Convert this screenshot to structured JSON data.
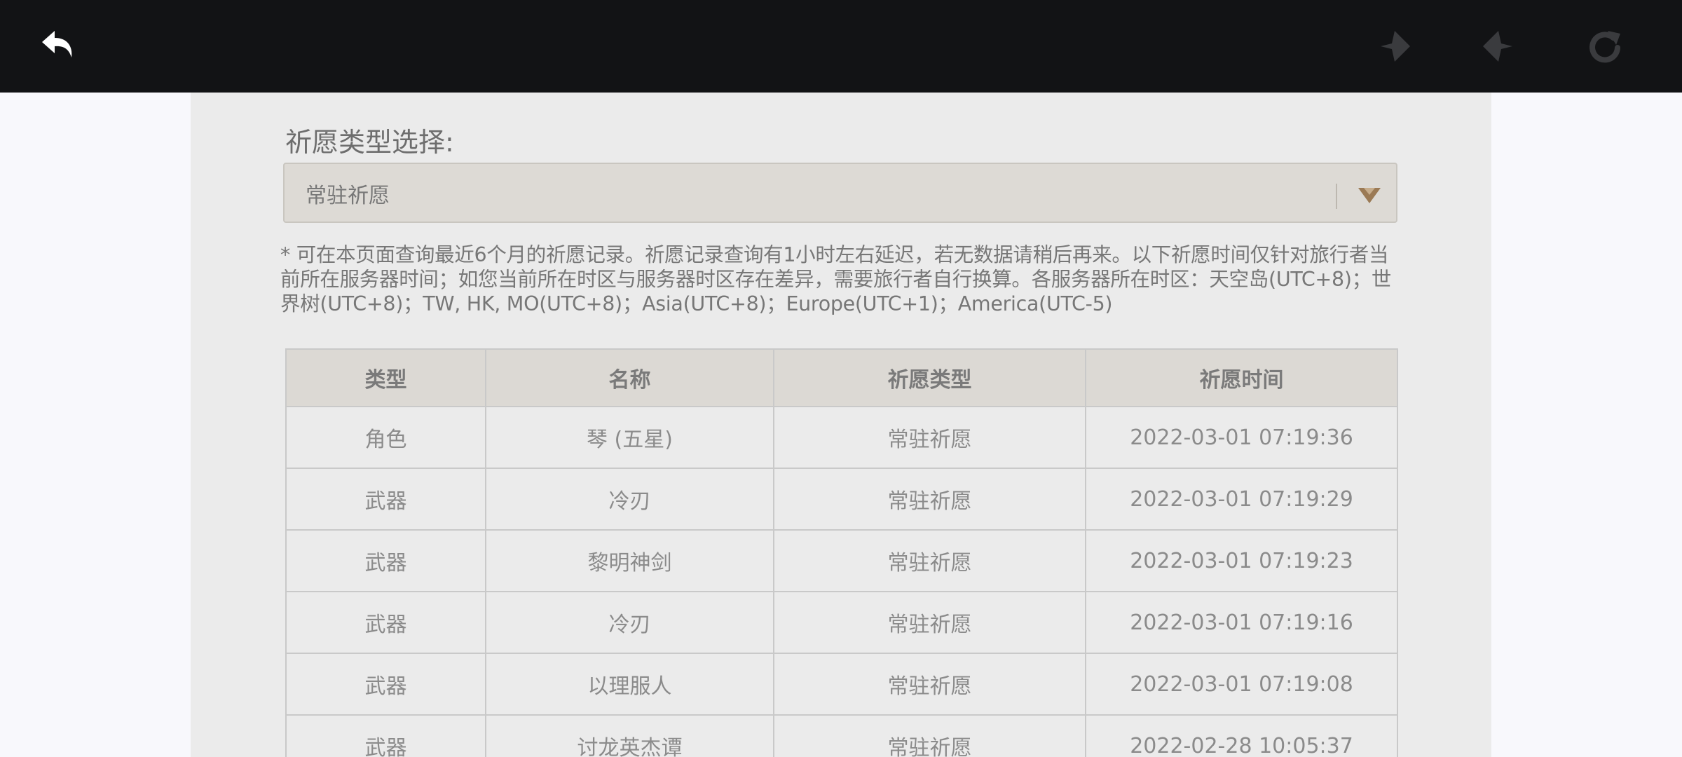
{
  "toolbar": {
    "back_icon": "undo-arrow-icon",
    "prev_icon": "diamond-left-icon",
    "next_icon": "diamond-right-icon",
    "refresh_icon": "refresh-icon",
    "bar_color": "#121315",
    "disabled_icon_color": "#3a3b3e"
  },
  "filter": {
    "label": "祈愿类型选择:",
    "selected": "常驻祈愿",
    "arrow_color": "#9b7a55"
  },
  "notice": "* 可在本页面查询最近6个月的祈愿记录。祈愿记录查询有1小时左右延迟，若无数据请稍后再来。以下祈愿时间仅针对旅行者当前所在服务器时间；如您当前所在时区与服务器时区存在差异，需要旅行者自行换算。各服务器所在时区：天空岛(UTC+8)；世界树(UTC+8)；TW, HK, MO(UTC+8)；Asia(UTC+8)；Europe(UTC+1)；America(UTC-5)",
  "table": {
    "headers": [
      "类型",
      "名称",
      "祈愿类型",
      "祈愿时间"
    ],
    "rows": [
      {
        "type": "角色",
        "name": "琴 (五星)",
        "wish_type": "常驻祈愿",
        "time": "2022-03-01 07:19:36"
      },
      {
        "type": "武器",
        "name": "冷刃",
        "wish_type": "常驻祈愿",
        "time": "2022-03-01 07:19:29"
      },
      {
        "type": "武器",
        "name": "黎明神剑",
        "wish_type": "常驻祈愿",
        "time": "2022-03-01 07:19:23"
      },
      {
        "type": "武器",
        "name": "冷刃",
        "wish_type": "常驻祈愿",
        "time": "2022-03-01 07:19:16"
      },
      {
        "type": "武器",
        "name": "以理服人",
        "wish_type": "常驻祈愿",
        "time": "2022-03-01 07:19:08"
      },
      {
        "type": "武器",
        "name": "讨龙英杰谭",
        "wish_type": "常驻祈愿",
        "time": "2022-02-28 10:05:37"
      }
    ],
    "five_star_color": "#b9764a"
  }
}
